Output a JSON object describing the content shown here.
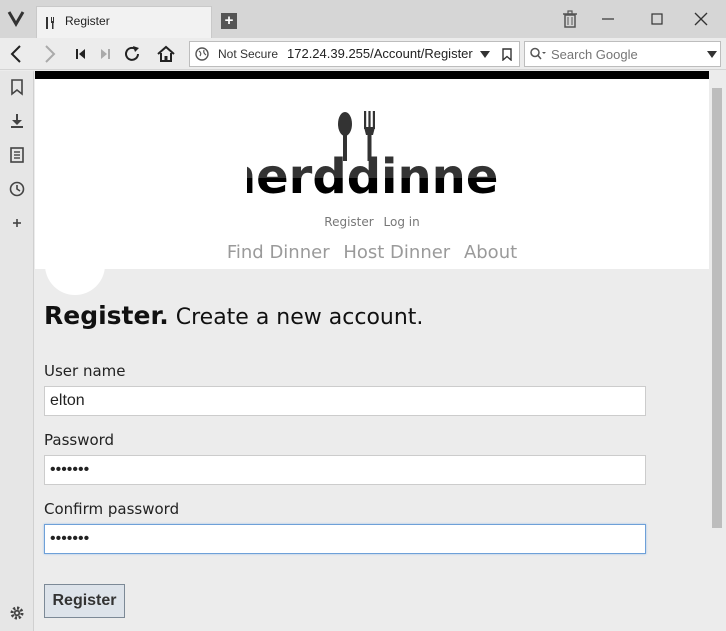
{
  "browser": {
    "tab_title": "Register",
    "address": {
      "security": "Not Secure",
      "url": "172.24.39.255/Account/Register"
    },
    "search": {
      "placeholder": "Search Google"
    }
  },
  "site": {
    "logo_text": "nerddinner",
    "login_links": [
      "Register",
      "Log in"
    ],
    "nav": [
      "Find Dinner",
      "Host Dinner",
      "About"
    ]
  },
  "form": {
    "heading_strong": "Register.",
    "heading_sub": "Create a new account.",
    "username_label": "User name",
    "username_value": "elton",
    "password_label": "Password",
    "password_value": "•••••••",
    "confirm_label": "Confirm password",
    "confirm_value": "•••••••",
    "submit_label": "Register"
  }
}
